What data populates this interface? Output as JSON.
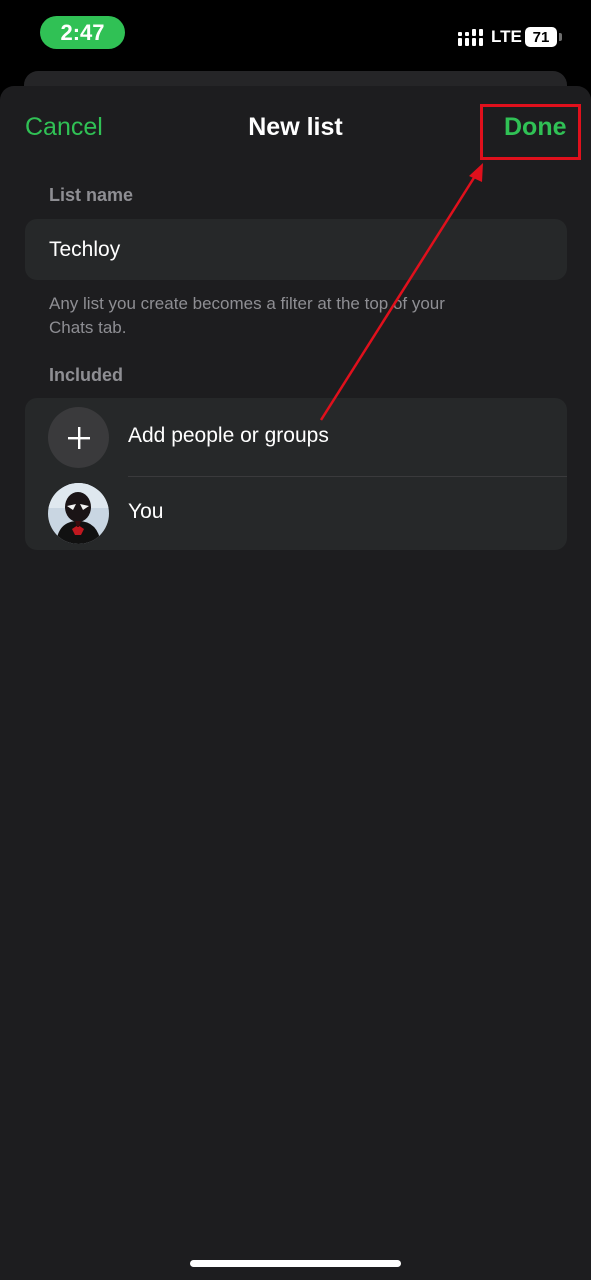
{
  "status_bar": {
    "time": "2:47",
    "network": "LTE",
    "battery": "71"
  },
  "nav": {
    "cancel_label": "Cancel",
    "title": "New list",
    "done_label": "Done"
  },
  "form": {
    "list_name_label": "List name",
    "list_name_value": "Techloy",
    "hint_line1": "Any list you create becomes a filter at the top of your",
    "hint_line2": "Chats tab.",
    "included_label": "Included",
    "add_label": "Add people or groups",
    "you_label": "You"
  },
  "colors": {
    "accent": "#30c155",
    "annotation": "#e0101c",
    "sheet_bg": "#1d1d1f",
    "card_bg": "#262829"
  },
  "icons": [
    "signal-icon",
    "battery-icon",
    "plus-icon",
    "avatar-image",
    "annotation-arrow"
  ]
}
